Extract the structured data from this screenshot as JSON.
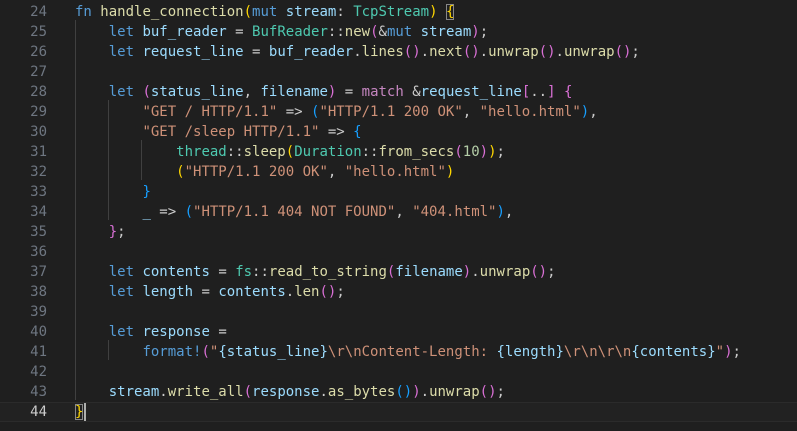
{
  "editor": {
    "language": "rust",
    "current_line": "44",
    "lines": [
      {
        "number": "24",
        "tokens": [
          {
            "t": "fn",
            "c": "k"
          },
          {
            "t": " "
          },
          {
            "t": "handle_connection",
            "c": "f"
          },
          {
            "t": "(",
            "c": "b1"
          },
          {
            "t": "mut",
            "c": "k"
          },
          {
            "t": " "
          },
          {
            "t": "stream",
            "c": "v"
          },
          {
            "t": ": "
          },
          {
            "t": "TcpStream",
            "c": "t"
          },
          {
            "t": ")",
            "c": "b1"
          },
          {
            "t": " "
          },
          {
            "t": "{",
            "c": "b1 bm"
          }
        ]
      },
      {
        "number": "25",
        "tokens": [
          {
            "t": "    "
          },
          {
            "t": "let",
            "c": "k"
          },
          {
            "t": " "
          },
          {
            "t": "buf_reader",
            "c": "v"
          },
          {
            "t": " = "
          },
          {
            "t": "BufReader",
            "c": "t"
          },
          {
            "t": "::"
          },
          {
            "t": "new",
            "c": "f"
          },
          {
            "t": "(",
            "c": "b2"
          },
          {
            "t": "&"
          },
          {
            "t": "mut",
            "c": "k"
          },
          {
            "t": " "
          },
          {
            "t": "stream",
            "c": "v"
          },
          {
            "t": ")",
            "c": "b2"
          },
          {
            "t": ";"
          }
        ]
      },
      {
        "number": "26",
        "tokens": [
          {
            "t": "    "
          },
          {
            "t": "let",
            "c": "k"
          },
          {
            "t": " "
          },
          {
            "t": "request_line",
            "c": "v"
          },
          {
            "t": " = "
          },
          {
            "t": "buf_reader",
            "c": "v"
          },
          {
            "t": "."
          },
          {
            "t": "lines",
            "c": "f"
          },
          {
            "t": "()",
            "c": "b2"
          },
          {
            "t": "."
          },
          {
            "t": "next",
            "c": "f"
          },
          {
            "t": "()",
            "c": "b2"
          },
          {
            "t": "."
          },
          {
            "t": "unwrap",
            "c": "f"
          },
          {
            "t": "()",
            "c": "b2"
          },
          {
            "t": "."
          },
          {
            "t": "unwrap",
            "c": "f"
          },
          {
            "t": "()",
            "c": "b2"
          },
          {
            "t": ";"
          }
        ]
      },
      {
        "number": "27",
        "tokens": []
      },
      {
        "number": "28",
        "tokens": [
          {
            "t": "    "
          },
          {
            "t": "let",
            "c": "k"
          },
          {
            "t": " "
          },
          {
            "t": "(",
            "c": "b2"
          },
          {
            "t": "status_line",
            "c": "v"
          },
          {
            "t": ", "
          },
          {
            "t": "filename",
            "c": "v"
          },
          {
            "t": ")",
            "c": "b2"
          },
          {
            "t": " = "
          },
          {
            "t": "match",
            "c": "cf"
          },
          {
            "t": " &"
          },
          {
            "t": "request_line",
            "c": "v"
          },
          {
            "t": "[",
            "c": "b2"
          },
          {
            "t": ".."
          },
          {
            "t": "]",
            "c": "b2"
          },
          {
            "t": " "
          },
          {
            "t": "{",
            "c": "b2"
          }
        ]
      },
      {
        "number": "29",
        "tokens": [
          {
            "t": "        "
          },
          {
            "t": "\"GET / HTTP/1.1\"",
            "c": "s"
          },
          {
            "t": " => "
          },
          {
            "t": "(",
            "c": "b3"
          },
          {
            "t": "\"HTTP/1.1 200 OK\"",
            "c": "s"
          },
          {
            "t": ", "
          },
          {
            "t": "\"hello.html\"",
            "c": "s"
          },
          {
            "t": ")",
            "c": "b3"
          },
          {
            "t": ","
          }
        ]
      },
      {
        "number": "30",
        "tokens": [
          {
            "t": "        "
          },
          {
            "t": "\"GET /sleep HTTP/1.1\"",
            "c": "s"
          },
          {
            "t": " => "
          },
          {
            "t": "{",
            "c": "b3"
          }
        ]
      },
      {
        "number": "31",
        "tokens": [
          {
            "t": "            "
          },
          {
            "t": "thread",
            "c": "t"
          },
          {
            "t": "::"
          },
          {
            "t": "sleep",
            "c": "f"
          },
          {
            "t": "(",
            "c": "b1"
          },
          {
            "t": "Duration",
            "c": "t"
          },
          {
            "t": "::"
          },
          {
            "t": "from_secs",
            "c": "f"
          },
          {
            "t": "(",
            "c": "b2"
          },
          {
            "t": "10",
            "c": "n"
          },
          {
            "t": ")",
            "c": "b2"
          },
          {
            "t": ")",
            "c": "b1"
          },
          {
            "t": ";"
          }
        ]
      },
      {
        "number": "32",
        "tokens": [
          {
            "t": "            "
          },
          {
            "t": "(",
            "c": "b1"
          },
          {
            "t": "\"HTTP/1.1 200 OK\"",
            "c": "s"
          },
          {
            "t": ", "
          },
          {
            "t": "\"hello.html\"",
            "c": "s"
          },
          {
            "t": ")",
            "c": "b1"
          }
        ]
      },
      {
        "number": "33",
        "tokens": [
          {
            "t": "        "
          },
          {
            "t": "}",
            "c": "b3"
          }
        ]
      },
      {
        "number": "34",
        "tokens": [
          {
            "t": "        "
          },
          {
            "t": "_",
            "c": "v"
          },
          {
            "t": " => "
          },
          {
            "t": "(",
            "c": "b3"
          },
          {
            "t": "\"HTTP/1.1 404 NOT FOUND\"",
            "c": "s"
          },
          {
            "t": ", "
          },
          {
            "t": "\"404.html\"",
            "c": "s"
          },
          {
            "t": ")",
            "c": "b3"
          },
          {
            "t": ","
          }
        ]
      },
      {
        "number": "35",
        "tokens": [
          {
            "t": "    "
          },
          {
            "t": "}",
            "c": "b2"
          },
          {
            "t": ";"
          }
        ]
      },
      {
        "number": "36",
        "tokens": []
      },
      {
        "number": "37",
        "tokens": [
          {
            "t": "    "
          },
          {
            "t": "let",
            "c": "k"
          },
          {
            "t": " "
          },
          {
            "t": "contents",
            "c": "v"
          },
          {
            "t": " = "
          },
          {
            "t": "fs",
            "c": "t"
          },
          {
            "t": "::"
          },
          {
            "t": "read_to_string",
            "c": "f"
          },
          {
            "t": "(",
            "c": "b2"
          },
          {
            "t": "filename",
            "c": "v"
          },
          {
            "t": ")",
            "c": "b2"
          },
          {
            "t": "."
          },
          {
            "t": "unwrap",
            "c": "f"
          },
          {
            "t": "()",
            "c": "b2"
          },
          {
            "t": ";"
          }
        ]
      },
      {
        "number": "38",
        "tokens": [
          {
            "t": "    "
          },
          {
            "t": "let",
            "c": "k"
          },
          {
            "t": " "
          },
          {
            "t": "length",
            "c": "v"
          },
          {
            "t": " = "
          },
          {
            "t": "contents",
            "c": "v"
          },
          {
            "t": "."
          },
          {
            "t": "len",
            "c": "f"
          },
          {
            "t": "()",
            "c": "b2"
          },
          {
            "t": ";"
          }
        ]
      },
      {
        "number": "39",
        "tokens": []
      },
      {
        "number": "40",
        "tokens": [
          {
            "t": "    "
          },
          {
            "t": "let",
            "c": "k"
          },
          {
            "t": " "
          },
          {
            "t": "response",
            "c": "v"
          },
          {
            "t": " ="
          }
        ]
      },
      {
        "number": "41",
        "tokens": [
          {
            "t": "        "
          },
          {
            "t": "format!",
            "c": "m"
          },
          {
            "t": "(",
            "c": "b2"
          },
          {
            "t": "\"",
            "c": "s"
          },
          {
            "t": "{status_line}",
            "c": "v"
          },
          {
            "t": "\\r\\n",
            "c": "s"
          },
          {
            "t": "Content-Length: ",
            "c": "s"
          },
          {
            "t": "{length}",
            "c": "v"
          },
          {
            "t": "\\r\\n\\r\\n",
            "c": "s"
          },
          {
            "t": "{contents}",
            "c": "v"
          },
          {
            "t": "\"",
            "c": "s"
          },
          {
            "t": ")",
            "c": "b2"
          },
          {
            "t": ";"
          }
        ]
      },
      {
        "number": "42",
        "tokens": []
      },
      {
        "number": "43",
        "tokens": [
          {
            "t": "    "
          },
          {
            "t": "stream",
            "c": "v"
          },
          {
            "t": "."
          },
          {
            "t": "write_all",
            "c": "f"
          },
          {
            "t": "(",
            "c": "b2"
          },
          {
            "t": "response",
            "c": "v"
          },
          {
            "t": "."
          },
          {
            "t": "as_bytes",
            "c": "f"
          },
          {
            "t": "()",
            "c": "b3"
          },
          {
            "t": ")",
            "c": "b2"
          },
          {
            "t": "."
          },
          {
            "t": "unwrap",
            "c": "f"
          },
          {
            "t": "()",
            "c": "b2"
          },
          {
            "t": ";"
          }
        ]
      },
      {
        "number": "44",
        "tokens": [
          {
            "t": "}",
            "c": "b1 bm"
          }
        ]
      }
    ]
  }
}
